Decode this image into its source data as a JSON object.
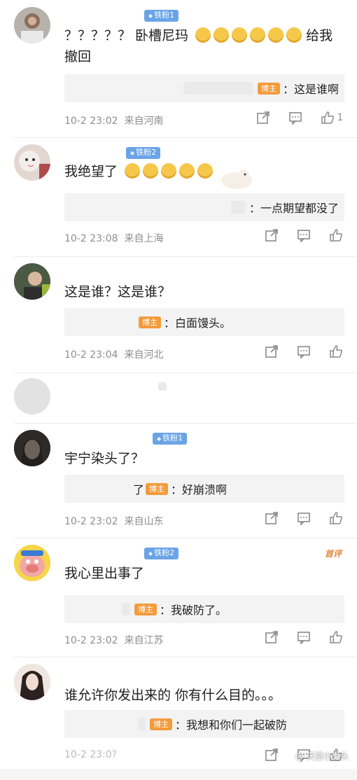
{
  "comments": [
    {
      "badge": "铁粉1",
      "text": "？？？？？ 卧槽尼玛",
      "text_after": "给我",
      "text_line2": "撤回",
      "emoji_count": 6,
      "reply_tag": "博主",
      "reply_text": "：这是谁啊",
      "time": "10-2 23:02",
      "location": "来自河南",
      "like_count": "1"
    },
    {
      "badge": "铁粉2",
      "text": "我绝望了",
      "emoji_count": 5,
      "reply_tag": "",
      "reply_text": "：一点期望都没了",
      "time": "10-2 23:08",
      "location": "来自上海"
    },
    {
      "text": "这是谁？这是谁？",
      "reply_tag": "博主",
      "reply_text": "：白面馒头。",
      "time": "10-2 23:04",
      "location": "来自河北"
    },
    {
      "badge": "铁粉1",
      "text": "宇宁染头了？",
      "reply_prefix": "了",
      "reply_tag": "博主",
      "reply_text": "：好崩溃啊",
      "time": "10-2 23:02",
      "location": "来自山东"
    },
    {
      "badge": "铁粉2",
      "top_label": "首评",
      "text": "我心里出事了",
      "reply_tag": "博主",
      "reply_text": "：我破防了。",
      "time": "10-2 23:02",
      "location": "来自江苏"
    },
    {
      "text": "谁允许你发出来的 你有什么目的。。。",
      "reply_tag": "博主",
      "reply_text": "：我想和你们一起破防",
      "time": "10-2 23:0?",
      "location": ""
    }
  ],
  "watermark": "@ 天堂小鬼头",
  "colors": {
    "badge": "#6aa4e6",
    "blogger_tag": "#f39b3b",
    "meta": "#8d8d8d",
    "reply_bg": "#f3f3f3"
  },
  "icons": [
    "share-icon",
    "comment-icon",
    "like-icon"
  ]
}
